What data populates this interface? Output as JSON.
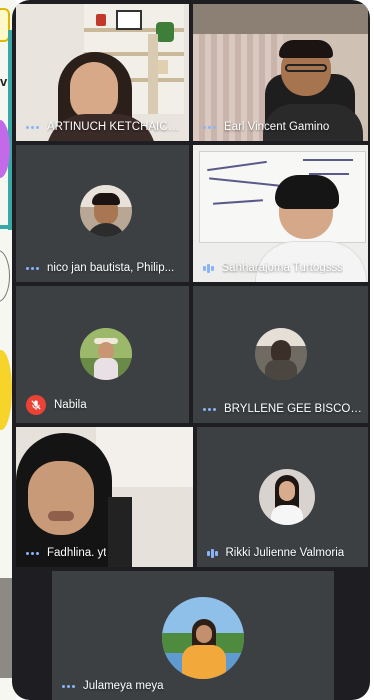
{
  "participants": [
    {
      "name": "ARTINUCH KETCHAICH...",
      "status": "speaking"
    },
    {
      "name": "Earl Vincent Gamino",
      "status": "speaking"
    },
    {
      "name": "nico jan bautista, Philip...",
      "status": "speaking"
    },
    {
      "name": "Sahharajoma Turtogsss",
      "status": "audio-level"
    },
    {
      "name": "Nabila",
      "status": "muted"
    },
    {
      "name": "BRYLLENE GEE BISCON...",
      "status": "speaking"
    },
    {
      "name": "Fadhlina. yt",
      "status": "speaking"
    },
    {
      "name": "Rikki Julienne Valmoria",
      "status": "audio-level"
    },
    {
      "name": "Julameya meya",
      "status": "speaking"
    }
  ],
  "left_slide": {
    "text": "v"
  },
  "colors": {
    "tile": "#3c4043",
    "frame": "#1e1e22",
    "indicator": "#8ab4f8",
    "mute": "#ea4335"
  }
}
